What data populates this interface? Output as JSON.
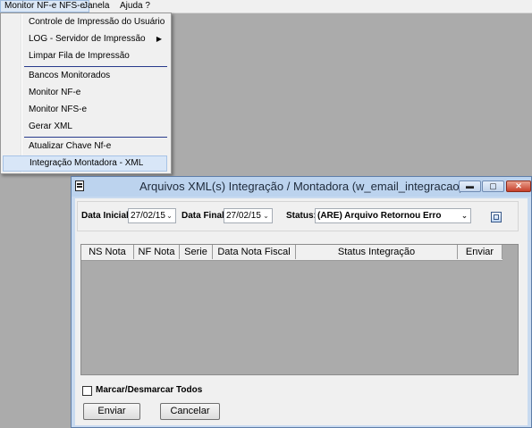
{
  "menubar": {
    "items": [
      {
        "label": "Monitor NF-e NFS-e"
      },
      {
        "label": "Janela"
      },
      {
        "label": "Ajuda ?"
      }
    ]
  },
  "dropdown": {
    "items": [
      {
        "label": "Controle de Impressão do Usuário"
      },
      {
        "label": "LOG - Servidor de Impressão",
        "submenu_arrow": "▶"
      },
      {
        "label": "Limpar Fila de Impressão"
      },
      {
        "label": "Bancos Monitorados"
      },
      {
        "label": "Monitor NF-e"
      },
      {
        "label": "Monitor NFS-e"
      },
      {
        "label": "Gerar XML"
      },
      {
        "label": "Atualizar Chave Nf-e"
      },
      {
        "label": "Integração Montadora - XML",
        "highlighted": true
      }
    ]
  },
  "window": {
    "title": "Arquivos XML(s) Integração / Montadora (w_email_integracao)",
    "controls": {
      "minimize": "▬",
      "restore": "▢",
      "close": "✕"
    },
    "filters": {
      "data_inicial_label": "Data Inicial:",
      "data_inicial_value": "27/02/15",
      "data_final_label": "Data Final:",
      "data_final_value": "27/02/15",
      "status_label": "Status:",
      "status_value": "(ARE) Arquivo Retornou Erro"
    },
    "grid": {
      "columns": [
        "NS Nota",
        "NF Nota",
        "Serie",
        "Data Nota Fiscal",
        "Status Integração",
        "Enviar"
      ],
      "rows": []
    },
    "checkbox": {
      "label": "Marcar/Desmarcar Todos",
      "checked": false
    },
    "buttons": {
      "send": "Enviar",
      "cancel": "Cancelar"
    }
  },
  "icons": {
    "dropdown_arrow": "⌄",
    "window_icon": "window-icon",
    "refresh_icon": "refresh-icon"
  },
  "colors": {
    "highlight": "#d8e6f7",
    "window_frame": "#c8daf0",
    "mdi_background": "#ababab",
    "close_button": "#c6402b"
  }
}
